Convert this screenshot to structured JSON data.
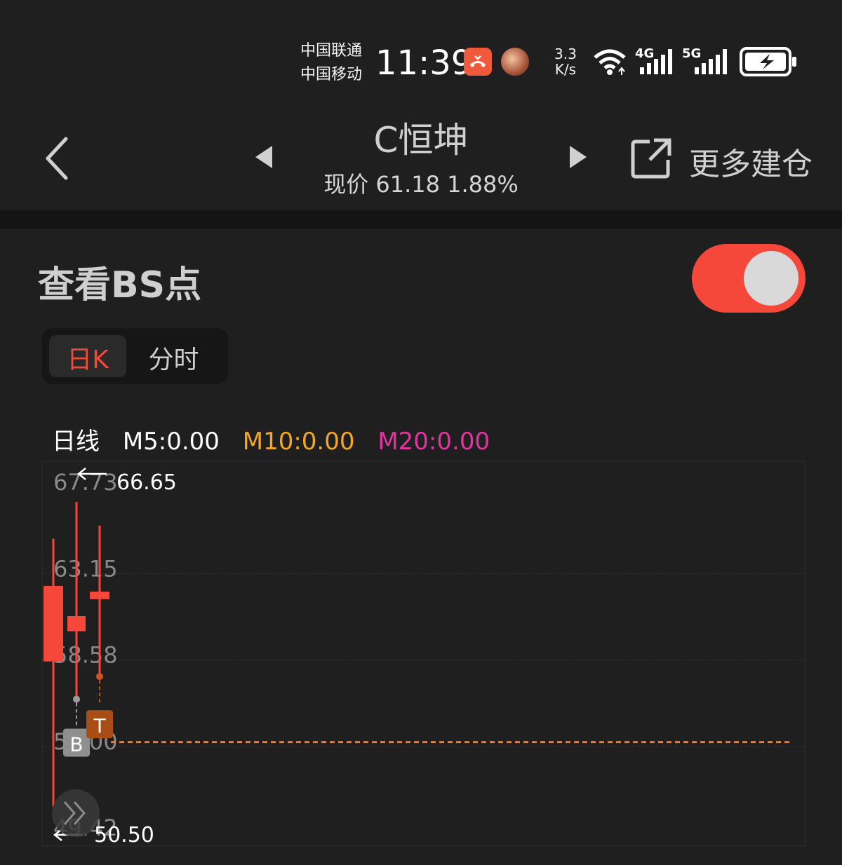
{
  "status_bar": {
    "carrier1": "中国联通",
    "carrier2": "中国移动",
    "time": "11:39",
    "net_speed_value": "3.3",
    "net_speed_unit": "K/s",
    "sig1_label": "4G",
    "sig2_label": "5G"
  },
  "header": {
    "title": "C恒坤",
    "subtitle": "现价 61.18 1.88%",
    "more_label": "更多建仓"
  },
  "bs_section": {
    "title": "查看BS点",
    "toggle_on": true,
    "toggle_color": "#f5473a"
  },
  "tabs": [
    {
      "label": "日K",
      "active": true
    },
    {
      "label": "分时",
      "active": false
    }
  ],
  "ma_legend": {
    "line": "日线",
    "m5": "M5:0.00",
    "m10": "M10:0.00",
    "m20": "M20:0.00",
    "colors": {
      "m5": "#ffffff",
      "m10": "#f5a623",
      "m20": "#e0359e"
    }
  },
  "chart_data": {
    "type": "candlestick",
    "ylim": [
      49.42,
      67.73
    ],
    "y_ticks": [
      "67.73",
      "63.15",
      "58.58",
      "54.00",
      "49.42"
    ],
    "max_label": "66.65",
    "min_label": "50.50",
    "reference_line": 54.0,
    "candles": [
      {
        "open": 58.2,
        "close": 62.2,
        "high": 64.7,
        "low": 50.5
      },
      {
        "open": 59.8,
        "close": 60.6,
        "high": 66.65,
        "low": 56.2
      },
      {
        "open": 61.5,
        "close": 61.9,
        "high": 65.4,
        "low": 57.4
      }
    ],
    "markers": [
      {
        "label": "B",
        "candle": 1,
        "price": 56.2
      },
      {
        "label": "T",
        "candle": 2,
        "price": 57.4
      }
    ],
    "up_color": "#f5473a",
    "grid": true
  }
}
